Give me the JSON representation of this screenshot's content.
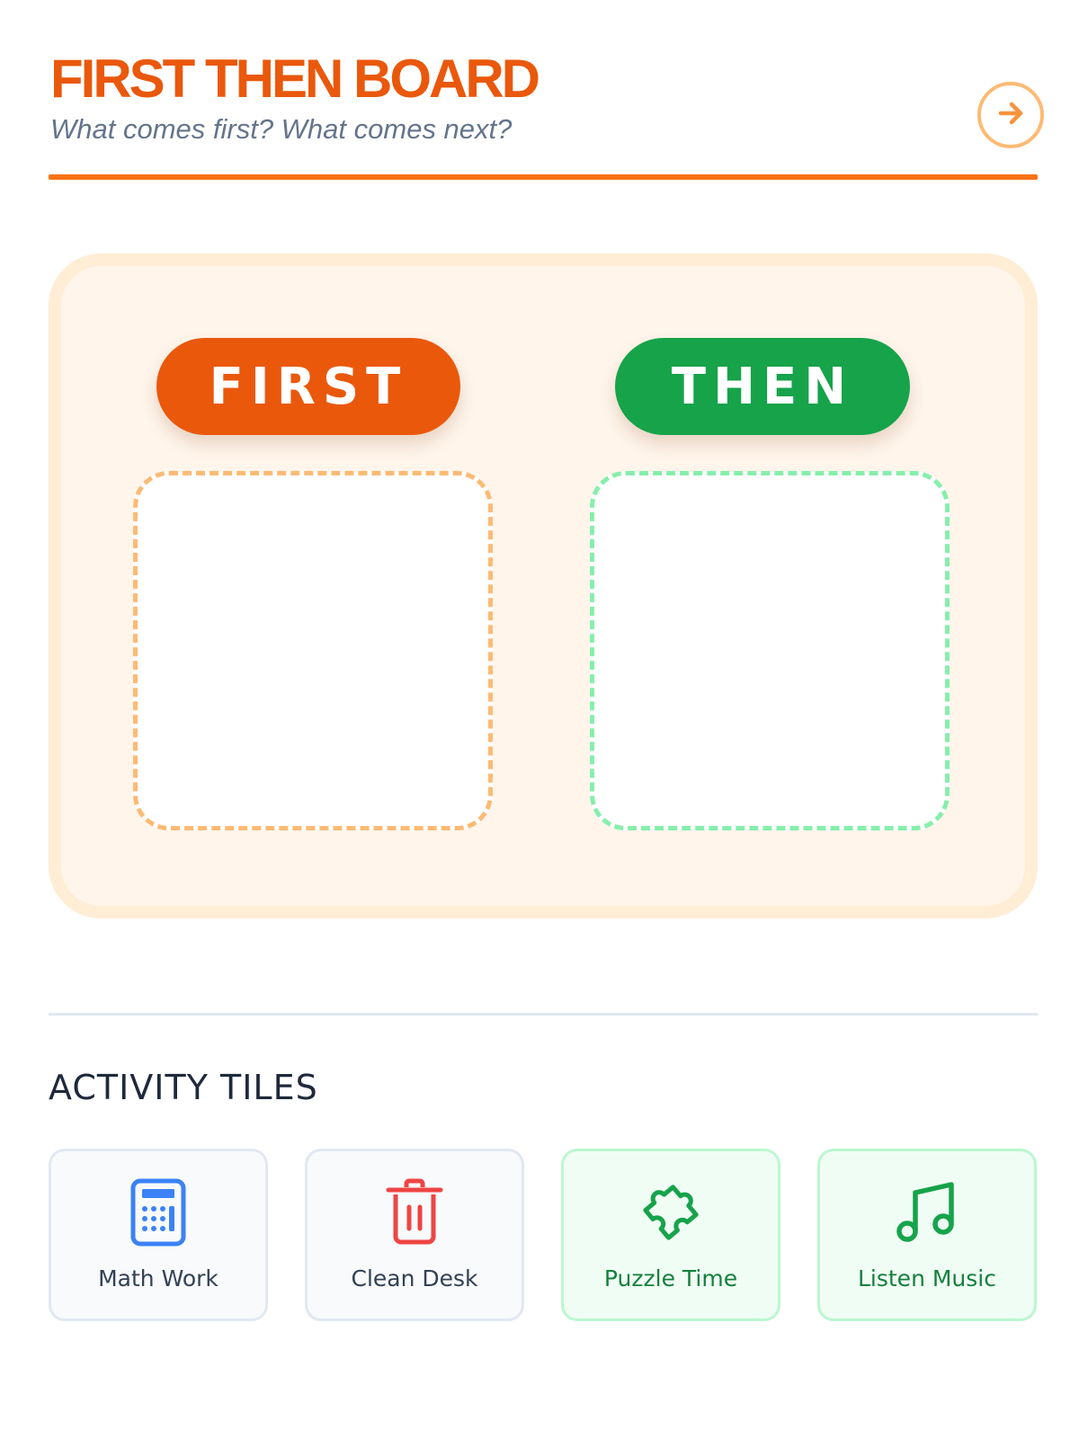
{
  "header": {
    "title": "FIRST THEN BOARD",
    "subtitle": "What comes first? What comes next?",
    "next_icon": "arrow-right-circle-icon"
  },
  "board": {
    "first_label": "FIRST",
    "then_label": "THEN"
  },
  "activity_section": {
    "title": "ACTIVITY TILES",
    "tiles": [
      {
        "label": "Math Work",
        "icon": "calculator-icon",
        "color": "#3b82f6"
      },
      {
        "label": "Clean Desk",
        "icon": "trash-icon",
        "color": "#ef4444"
      },
      {
        "label": "Puzzle Time",
        "icon": "puzzle-icon",
        "color": "#16a34a"
      },
      {
        "label": "Listen Music",
        "icon": "music-note-icon",
        "color": "#16a34a"
      }
    ]
  },
  "colors": {
    "accent": "#ea580c",
    "then_green": "#16a34a",
    "board_bg": "#fff5eb",
    "first_dash": "#fdba74",
    "then_dash": "#86efac"
  }
}
